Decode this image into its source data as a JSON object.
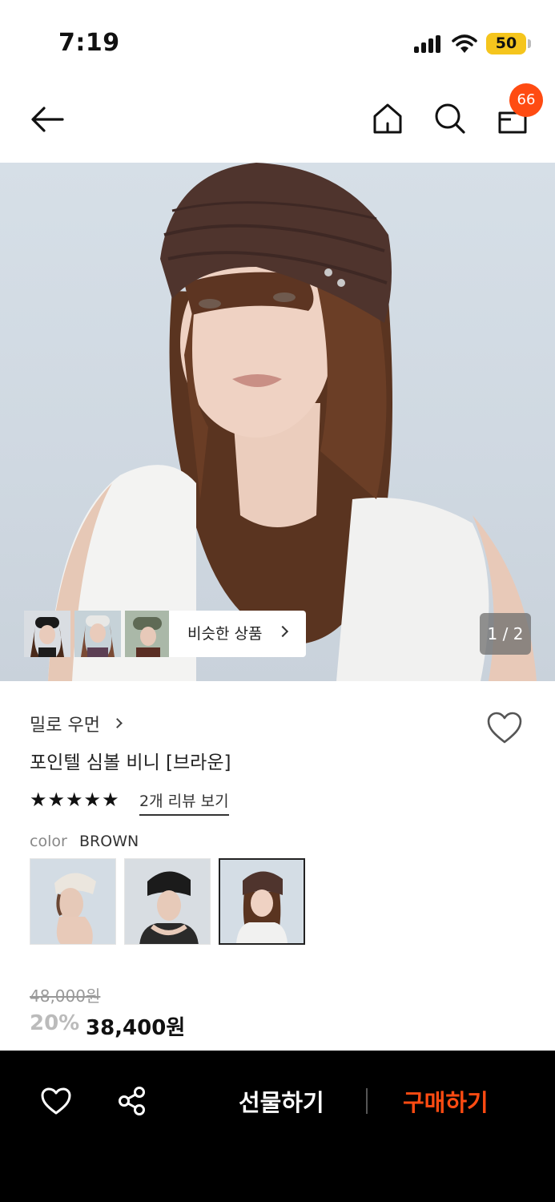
{
  "status_bar": {
    "time": "7:19",
    "battery": "50"
  },
  "nav": {
    "cart_count": "66",
    "icons": [
      "back-arrow-icon",
      "home-icon",
      "search-icon",
      "cart-bag-icon"
    ]
  },
  "hero": {
    "similar_label": "비슷한 상품",
    "pager": "1 / 2"
  },
  "product": {
    "brand": "밀로 우먼",
    "title": "포인텔 심볼 비니 [브라운]",
    "rating_stars": 5,
    "reviews_link": "2개 리뷰 보기",
    "color_label": "color",
    "color_value": "BROWN",
    "color_options": [
      "ivory",
      "black",
      "brown"
    ],
    "selected_color_index": 2,
    "original_price": "48,000원",
    "discount": "20%",
    "price": "38,400원"
  },
  "bottom_bar": {
    "gift_label": "선물하기",
    "buy_label": "구매하기"
  },
  "colors": {
    "accent": "#ff4b12",
    "battery": "#f5c51d",
    "bar": "#000000"
  }
}
